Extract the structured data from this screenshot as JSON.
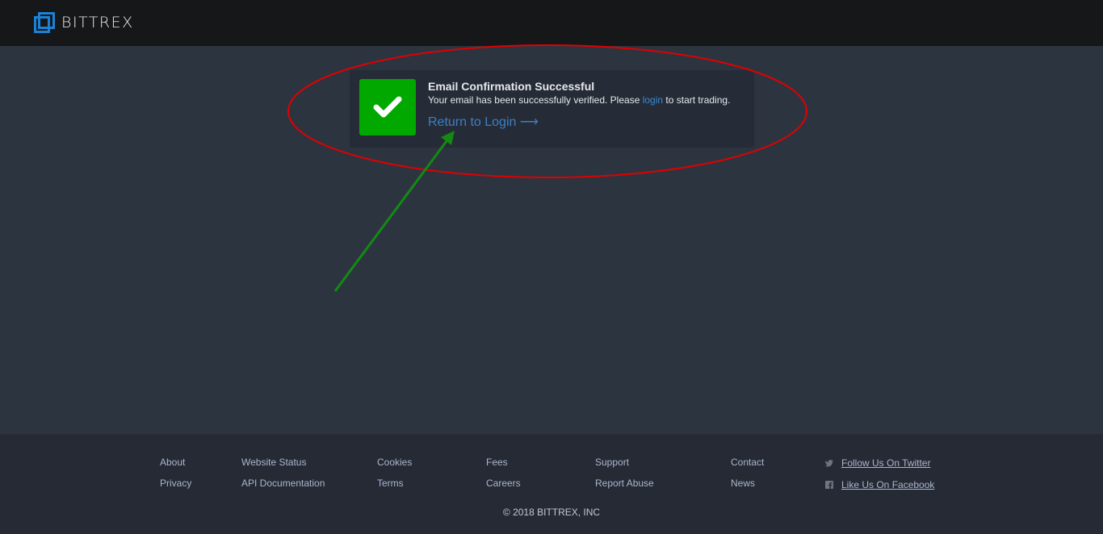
{
  "header": {
    "brand": "BITTREX",
    "logo_icon": "bittrex-logo-icon"
  },
  "confirmation": {
    "icon": "checkmark-icon",
    "status_color": "#00a800",
    "title": "Email Confirmation Successful",
    "body_prefix": "Your email has been successfully verified. Please ",
    "body_link": "login",
    "body_suffix": " to start trading.",
    "return_link": "Return to Login",
    "return_arrow": "⟶"
  },
  "footer": {
    "columns": [
      {
        "links": [
          "About",
          "Privacy"
        ]
      },
      {
        "links": [
          "Website Status",
          "API Documentation"
        ]
      },
      {
        "links": [
          "Cookies",
          "Terms"
        ]
      },
      {
        "links": [
          "Fees",
          "Careers"
        ]
      },
      {
        "links": [
          "Support",
          "Report Abuse"
        ]
      },
      {
        "links": [
          "Contact",
          "News"
        ]
      }
    ],
    "social": [
      {
        "icon": "twitter-icon",
        "label": "Follow Us On Twitter"
      },
      {
        "icon": "facebook-icon",
        "label": "Like Us On Facebook"
      }
    ],
    "copyright": "© 2018 BITTREX, INC"
  },
  "annotations": {
    "highlight_color": "#e00000",
    "arrow_color": "#138a13"
  }
}
